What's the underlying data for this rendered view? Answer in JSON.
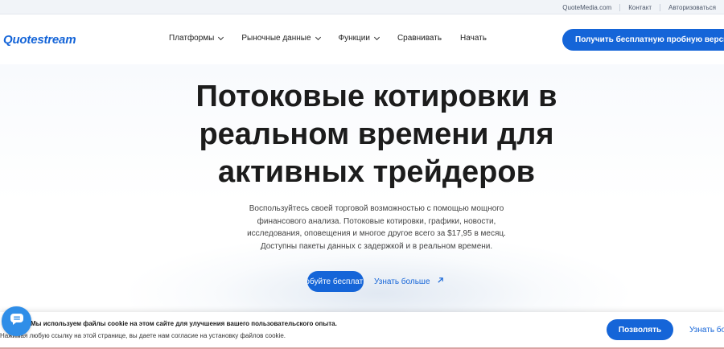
{
  "topbar": {
    "links": [
      "QuoteMedia.com",
      "Контакт",
      "Авторизоваться"
    ]
  },
  "header": {
    "logo": "Quotestream",
    "nav": [
      {
        "label": "Платформы",
        "has_dropdown": true
      },
      {
        "label": "Рыночные данные",
        "has_dropdown": true
      },
      {
        "label": "Функции",
        "has_dropdown": true
      },
      {
        "label": "Сравнивать",
        "has_dropdown": false
      },
      {
        "label": "Начать",
        "has_dropdown": false
      }
    ],
    "cta": "Получить бесплатную пробную версию"
  },
  "hero": {
    "title_lines": [
      "Потоковые котировки в",
      "реальном времени для",
      "активных трейдеров"
    ],
    "subtitle_lines": [
      "Воспользуйтесь своей торговой возможностью с помощью мощного",
      "финансового анализа. Потоковые котировки, графики, новости,",
      "исследования, оповещения и многое другое всего за $17,95 в месяц.",
      "Доступны пакеты данных с задержкой и в реальном времени."
    ],
    "try_button": "Попробуйте бесплатно",
    "learn_more": "Узнать больше"
  },
  "cookie": {
    "line1": "Мы используем файлы cookie на этом сайте для улучшения вашего пользовательского опыта.",
    "line2": "Нажимая любую ссылку на этой странице, вы даете нам согласие на установку файлов cookie.",
    "allow": "Позволять",
    "more": "Узнать больше"
  },
  "colors": {
    "accent": "#1565d8",
    "chat": "#2f8ee8"
  },
  "icons": {
    "nav_dropdown": "chevron-down-icon",
    "learn_more": "arrow-up-right-icon",
    "chat": "chat-icon"
  }
}
